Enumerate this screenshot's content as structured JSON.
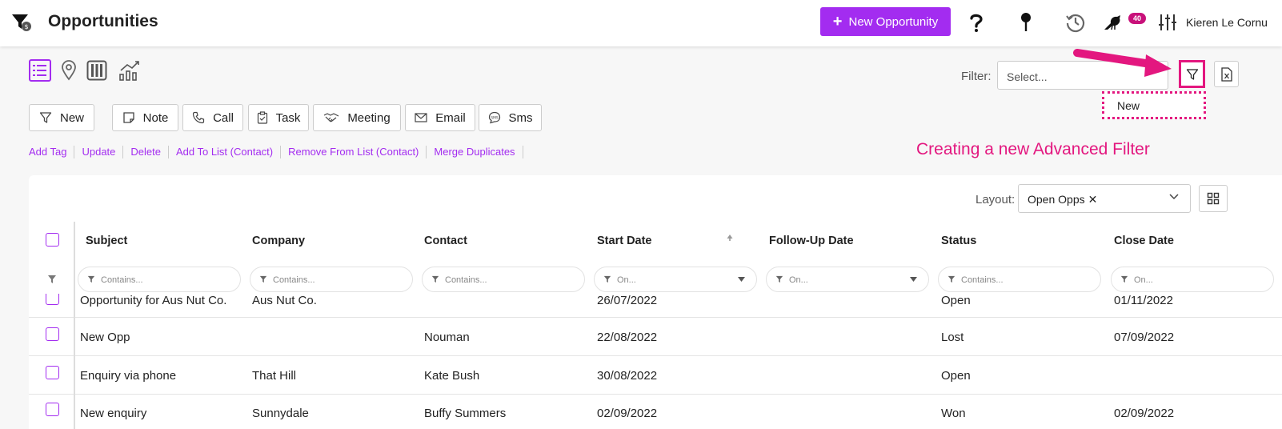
{
  "header": {
    "title": "Opportunities",
    "new_button": "New Opportunity",
    "notification_count": "40",
    "user_name": "Kieren Le Cornu"
  },
  "filter": {
    "label": "Filter:",
    "placeholder": "Select...",
    "dropdown_item": "New"
  },
  "annotation": "Creating a new Advanced Filter",
  "actions": [
    "New",
    "Note",
    "Call",
    "Task",
    "Meeting",
    "Email",
    "Sms"
  ],
  "links": [
    "Add Tag",
    "Update",
    "Delete",
    "Add To List (Contact)",
    "Remove From List (Contact)",
    "Merge Duplicates"
  ],
  "layout": {
    "label": "Layout:",
    "value": "Open Opps"
  },
  "table": {
    "columns": [
      "Subject",
      "Company",
      "Contact",
      "Start Date",
      "Follow-Up Date",
      "Status",
      "Close Date"
    ],
    "filters": [
      "Contains...",
      "Contains...",
      "Contains...",
      "On...",
      "On...",
      "Contains...",
      "On..."
    ],
    "rows": [
      [
        "Opportunity for Aus Nut Co.",
        "Aus Nut Co.",
        "",
        "26/07/2022",
        "",
        "Open",
        "01/11/2022"
      ],
      [
        "New Opp",
        "",
        "Nouman",
        "22/08/2022",
        "",
        "Lost",
        "07/09/2022"
      ],
      [
        "Enquiry via phone",
        "That Hill",
        "Kate Bush",
        "30/08/2022",
        "",
        "Open",
        ""
      ],
      [
        "New enquiry",
        "Sunnydale",
        "Buffy Summers",
        "02/09/2022",
        "",
        "Won",
        "02/09/2022"
      ]
    ]
  },
  "colors": {
    "accent": "#a32cf0",
    "annotation": "#e3177f",
    "badge": "#c8117a"
  }
}
